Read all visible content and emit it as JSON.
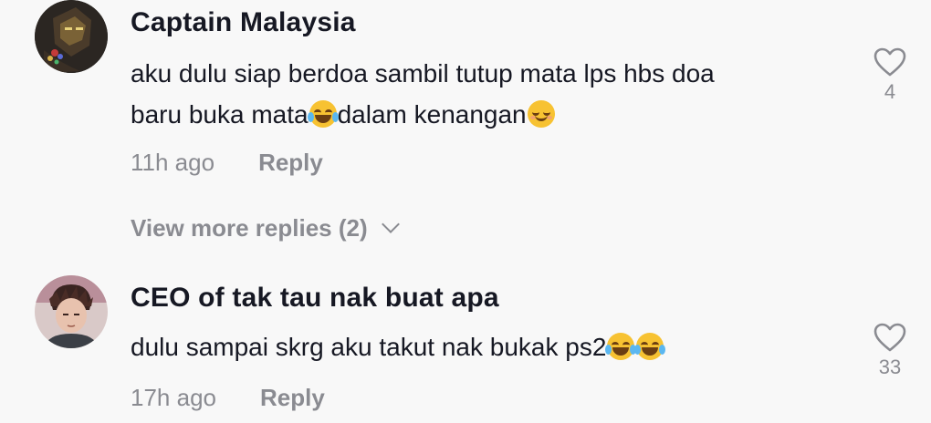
{
  "comments": [
    {
      "username": "Captain Malaysia",
      "text_line1": "aku dulu siap berdoa sambil tutup mata lps hbs doa",
      "text_line2a": "baru buka mata",
      "text_line2b": "dalam kenangan",
      "time": "11h ago",
      "reply_label": "Reply",
      "likes": "4",
      "avatar_icon": "iron-man-avatar"
    },
    {
      "username": "CEO of tak tau nak buat apa",
      "text": "dulu sampai skrg aku takut nak bukak ps2",
      "time": "17h ago",
      "reply_label": "Reply",
      "likes": "33",
      "avatar_icon": "anime-character-avatar"
    }
  ],
  "view_more_replies": "View more replies (2)",
  "colors": {
    "background": "#f8f8f8",
    "text": "#161823",
    "muted": "#8a8b91",
    "emoji": "#f7c232"
  }
}
